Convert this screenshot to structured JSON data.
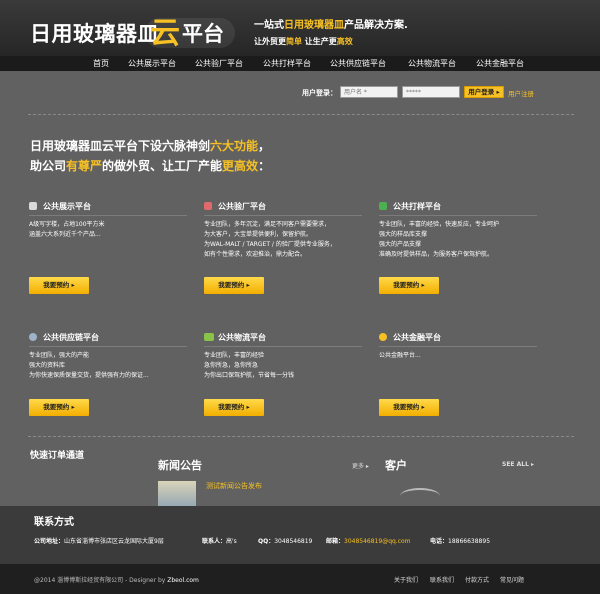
{
  "header": {
    "logo_main": "日用玻璃器皿",
    "logo_accent": "云",
    "logo_tail": "平台",
    "slogan1_pre": "一站式",
    "slogan1_hl": "日用玻璃器皿",
    "slogan1_post": "产品解决方案.",
    "slogan2_pre": "让外贸更",
    "slogan2_hl1": "简单",
    "slogan2_mid": "  让生产更",
    "slogan2_hl2": "高效"
  },
  "nav": {
    "items": [
      "首页",
      "公共展示平台",
      "公共验厂平台",
      "公共打样平台",
      "公共供应链平台",
      "公共物流平台",
      "公共金融平台"
    ]
  },
  "login": {
    "label": "用户登录：",
    "username_placeholder": "用户名 *",
    "password_value": "*****",
    "submit_label": "用户登录 ▸",
    "register_label": "用户注册"
  },
  "intro": {
    "line1_pre": "日用玻璃器皿云平台下设六脉神剑",
    "line1_hl": "六大功能",
    "line1_post": "，",
    "line2_pre": "助公司",
    "line2_hl1": "有尊严",
    "line2_mid": "的做外贸、让工厂产能",
    "line2_hl2": "更高效",
    "line2_post": "："
  },
  "features": [
    {
      "title": "公共展示平台",
      "desc": [
        "A级写字楼，占地100平方米",
        "涵盖六大系列近千个产品..."
      ],
      "button": "我要预约 ▸",
      "icon_color": "#d9d9d9"
    },
    {
      "title": "公共验厂平台",
      "desc": [
        "专业团队，多年沉淀，满足不同客户需要需求，",
        "为大客户，大宝单提供便利，保留护航。",
        "为WAL-MALT / TARGET / 的验厂提供专业服务，",
        "如有个性需求，欢迎推治，鼎力配合。"
      ],
      "button": "我要预约 ▸",
      "icon_color": "#e06a6a"
    },
    {
      "title": "公共打样平台",
      "desc": [
        "专业团队，丰富的经验，快速反应，专业呵护",
        "强大的样品库支撑",
        "强大的产品支撑",
        "准确及时提供样品，为服务客户保驾护航。"
      ],
      "button": "我要预约 ▸",
      "icon_color": "#4caf50"
    },
    {
      "title": "公共供应链平台",
      "desc": [
        "专业团队，强大的产能",
        "强大的资料库",
        "为你快速保质保量交货，提供强有力的保证..."
      ],
      "button": "我要预约 ▸",
      "icon_color": "#9fb3c8"
    },
    {
      "title": "公共物流平台",
      "desc": [
        "专业团队，丰富的经验",
        "急你所急，急你所急",
        "为你出口保驾护航，节省每一分钱"
      ],
      "button": "我要预约 ▸",
      "icon_color": "#8bc34a"
    },
    {
      "title": "公共金融平台",
      "desc": [
        "",
        "",
        "",
        "公共金融平台..."
      ],
      "button": "我要预约 ▸",
      "icon_color": "#f7c024"
    }
  ],
  "sections": {
    "quick_order": "快速订单通道",
    "news_title": "新闻公告",
    "news_more": "更多 ▸",
    "news_item": "测试新闻公告发布",
    "clients_title": "客户",
    "clients_more": "SEE ALL ▸"
  },
  "contact": {
    "title": "联系方式",
    "address_label": "公司地址：",
    "address_value": "山东省淄博市张店区云龙国际大厦9层",
    "person_label": "联系人：",
    "person_value": "高's",
    "qq_label": "QQ：",
    "qq_value": "3048546819",
    "email_label": "邮箱：",
    "email_value": "3048546819@qq.com",
    "phone_label": "电话：",
    "phone_value": "18866638895"
  },
  "footer": {
    "copyright_pre": "@2014 淄博博斯拉经贸有限公司 - Designer by ",
    "designer": "Zbeol.com",
    "links": [
      "关于我们",
      "联系我们",
      "付款方式",
      "常见问题"
    ]
  },
  "colors": {
    "accent": "#f7c024",
    "background": "#616161",
    "header": "#2e2e2e",
    "nav": "#1b1b1b"
  }
}
